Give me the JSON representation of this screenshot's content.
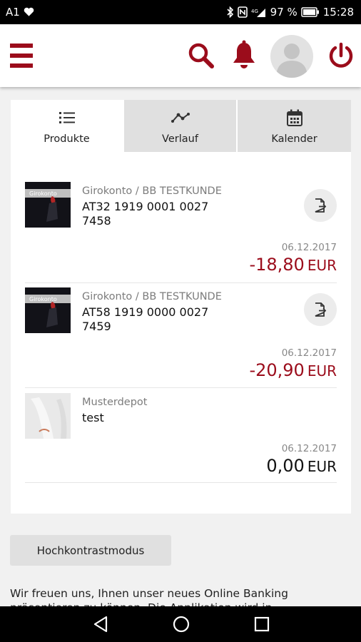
{
  "status_bar": {
    "carrier": "A1",
    "battery_percent": "97 %",
    "time": "15:28",
    "icons": [
      "heart-icon",
      "bluetooth-icon",
      "nfc-icon",
      "signal-icon",
      "battery-icon"
    ]
  },
  "app_bar": {
    "icons": [
      "menu-icon",
      "search-icon",
      "bell-icon",
      "avatar",
      "power-icon"
    ],
    "accent_color": "#9b0c1b"
  },
  "tabs": [
    {
      "label": "Produkte",
      "icon": "list-icon",
      "active": true
    },
    {
      "label": "Verlauf",
      "icon": "chart-line-icon",
      "active": false
    },
    {
      "label": "Kalender",
      "icon": "calendar-icon",
      "active": false
    }
  ],
  "products": [
    {
      "name": "Girokonto / BB TESTKUNDE",
      "number": "AT32 1919 0001 0027 7458",
      "thumb_label": "Girokonto",
      "date": "06.12.2017",
      "amount": "-18,80",
      "currency": "EUR",
      "negative": true
    },
    {
      "name": "Girokonto / BB TESTKUNDE",
      "number": "AT58 1919 0000 0027 7459",
      "thumb_label": "Girokonto",
      "date": "06.12.2017",
      "amount": "-20,90",
      "currency": "EUR",
      "negative": true
    },
    {
      "name": "Musterdepot",
      "number": "test",
      "date": "06.12.2017",
      "amount": "0,00",
      "currency": "EUR",
      "negative": false
    }
  ],
  "high_contrast_button": "Hochkontrastmodus",
  "welcome_text": "Wir freuen uns, Ihnen unser neues Online Banking präsentieren zu können. Die Applikation wird in",
  "nav_bar": {
    "icons": [
      "back-icon",
      "home-icon",
      "recents-icon"
    ]
  }
}
